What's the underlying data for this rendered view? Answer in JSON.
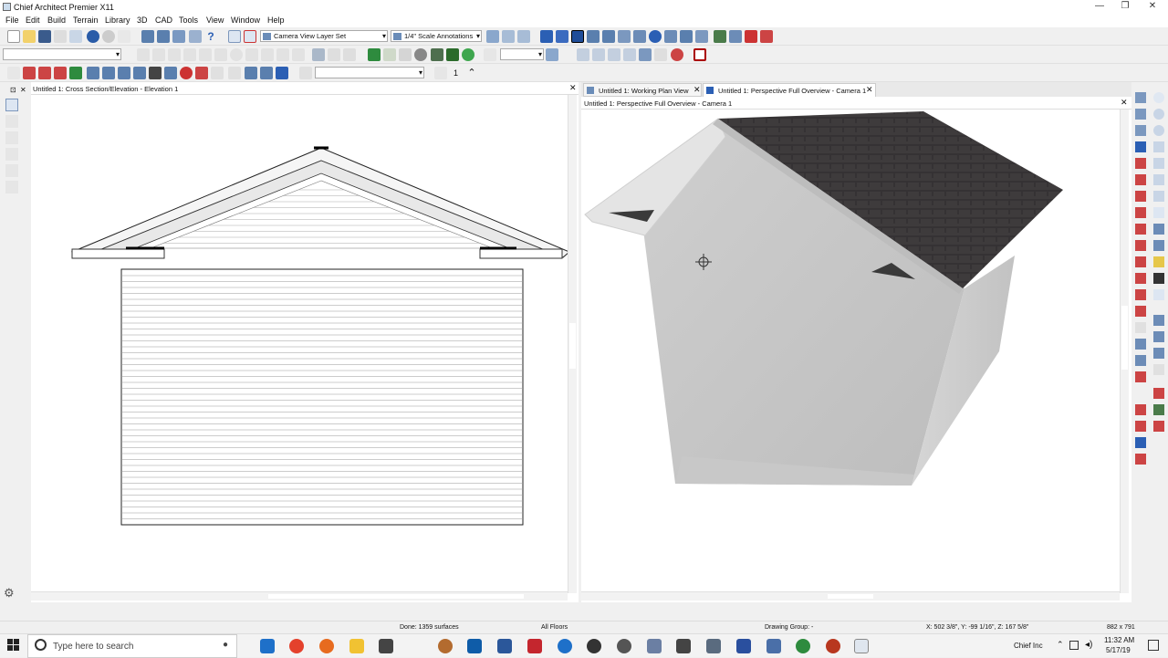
{
  "window": {
    "title": "Chief Architect Premier X11",
    "min": "—",
    "max": "❐",
    "close": "✕"
  },
  "menu": [
    "File",
    "Edit",
    "Build",
    "Terrain",
    "Library",
    "3D",
    "CAD",
    "Tools",
    "View",
    "Window",
    "Help"
  ],
  "toolbar": {
    "layer_set": "Camera View Layer Set",
    "annotation_set": "1/4\" Scale Annotations",
    "floor_number": "1"
  },
  "elevation": {
    "title": "Untitled 1: Cross Section/Elevation - Elevation 1"
  },
  "camera": {
    "tabs": [
      {
        "label": "Untitled 1:  Working Plan View",
        "active": false
      },
      {
        "label": "Untitled 1: Perspective Full Overview - Camera 1",
        "active": true
      }
    ],
    "title": "Untitled 1: Perspective Full Overview - Camera 1"
  },
  "status": {
    "done": "Done:  1359 surfaces",
    "floors": "All Floors",
    "drawing_group": "Drawing Group: -",
    "coords": "X: 502 3/8\", Y: -99 1/16\", Z: 167 5/8\"",
    "size": "882 x 791"
  },
  "taskbar": {
    "search_placeholder": "Type here to search",
    "account": "Chief Inc",
    "time": "11:32 AM",
    "date": "5/17/19"
  },
  "colors": {
    "roof": "#3e3b3c",
    "siding": "#c9c9c9",
    "accent": "#2b5fb4"
  }
}
